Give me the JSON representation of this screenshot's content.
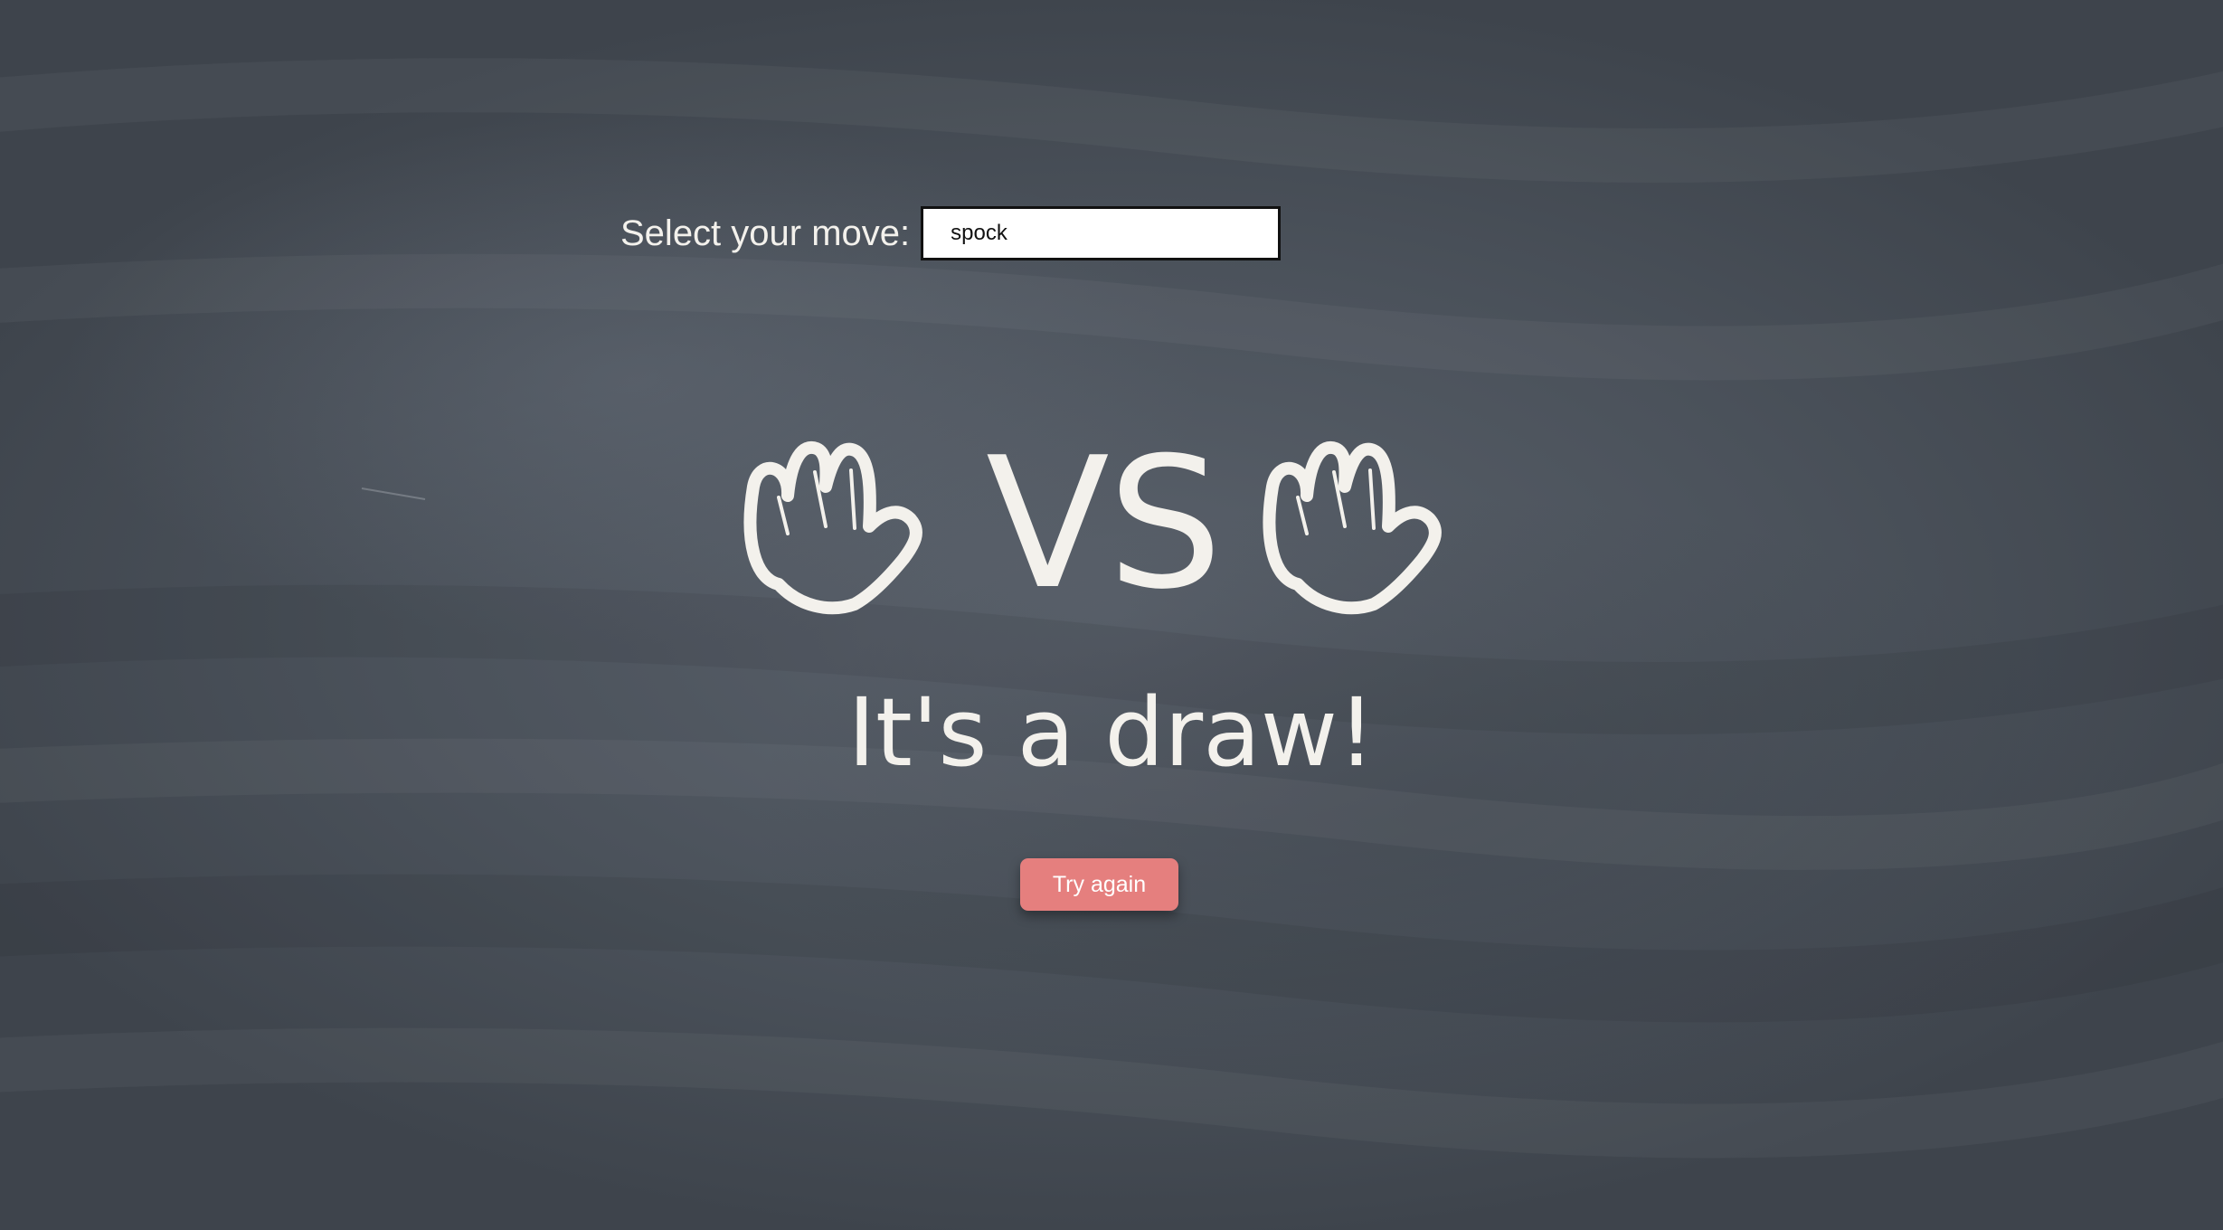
{
  "move_selector": {
    "label": "Select your move:",
    "selected_value": "spock"
  },
  "match": {
    "player_move_icon": "spock-hand-icon",
    "separator": "VS",
    "opponent_move_icon": "spock-hand-icon"
  },
  "result": {
    "message": "It's a draw!"
  },
  "actions": {
    "try_again_label": "Try again"
  },
  "colors": {
    "chalkboard": "#4b525b",
    "chalk_text": "#f3f1ec",
    "button": "#e57f7e"
  }
}
